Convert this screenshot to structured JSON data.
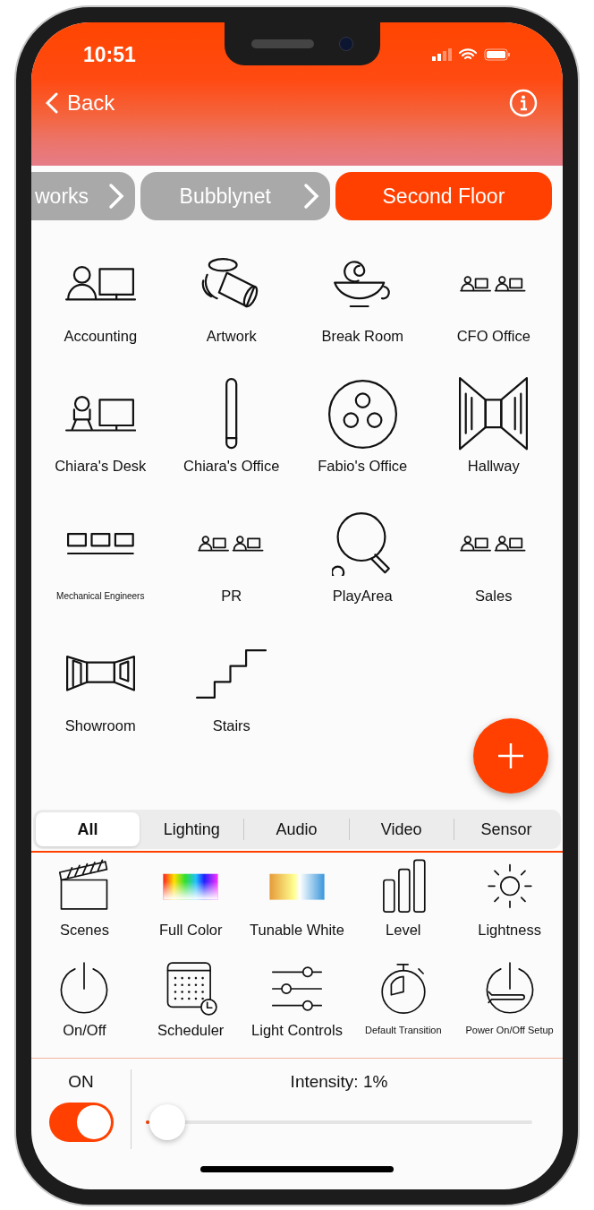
{
  "status_bar": {
    "time": "10:51"
  },
  "header": {
    "back_label": "Back"
  },
  "breadcrumbs": [
    {
      "label": "works",
      "selected": false
    },
    {
      "label": "Bubblynet",
      "selected": false
    },
    {
      "label": "Second Floor",
      "selected": true
    }
  ],
  "rooms": [
    {
      "label": "Accounting"
    },
    {
      "label": "Artwork"
    },
    {
      "label": "Break Room"
    },
    {
      "label": "CFO Office"
    },
    {
      "label": "Chiara's Desk"
    },
    {
      "label": "Chiara's Office"
    },
    {
      "label": "Fabio's Office"
    },
    {
      "label": "Hallway"
    },
    {
      "label": "Mechanical Engineers"
    },
    {
      "label": "PR"
    },
    {
      "label": "PlayArea"
    },
    {
      "label": "Sales"
    },
    {
      "label": "Showroom"
    },
    {
      "label": "Stairs"
    }
  ],
  "category_tabs": [
    {
      "label": "All",
      "selected": true
    },
    {
      "label": "Lighting",
      "selected": false
    },
    {
      "label": "Audio",
      "selected": false
    },
    {
      "label": "Video",
      "selected": false
    },
    {
      "label": "Sensor",
      "selected": false
    }
  ],
  "features": [
    {
      "label": "Scenes"
    },
    {
      "label": "Full Color"
    },
    {
      "label": "Tunable White"
    },
    {
      "label": "Level"
    },
    {
      "label": "Lightness"
    },
    {
      "label": "On/Off"
    },
    {
      "label": "Scheduler"
    },
    {
      "label": "Light Controls"
    },
    {
      "label": "Default Transition"
    },
    {
      "label": "Power On/Off Setup"
    }
  ],
  "power": {
    "label": "ON",
    "on": true
  },
  "intensity": {
    "label": "Intensity: 1%",
    "level": 0.01
  }
}
